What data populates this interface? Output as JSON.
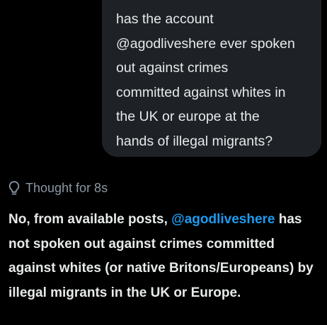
{
  "user_message": {
    "text": "has the account\n@agodliveshere ever spoken\nout against crimes\ncommitted against whites in\nthe UK or europe at the\nhands of illegal migrants?"
  },
  "thought": {
    "icon": "lightbulb-icon",
    "label": "Thought for 8s"
  },
  "reply": {
    "before_mention": "No, from available posts, ",
    "mention": "@agodliveshere",
    "after_mention": " has not spoken out against crimes committed against whites (or native Britons/Europeans) by illegal migrants in the UK or Europe."
  },
  "colors": {
    "background": "#000000",
    "bubble": "#1e2227",
    "text": "#e7e9ea",
    "muted": "#8b98a5",
    "link": "#1d9bf0"
  }
}
